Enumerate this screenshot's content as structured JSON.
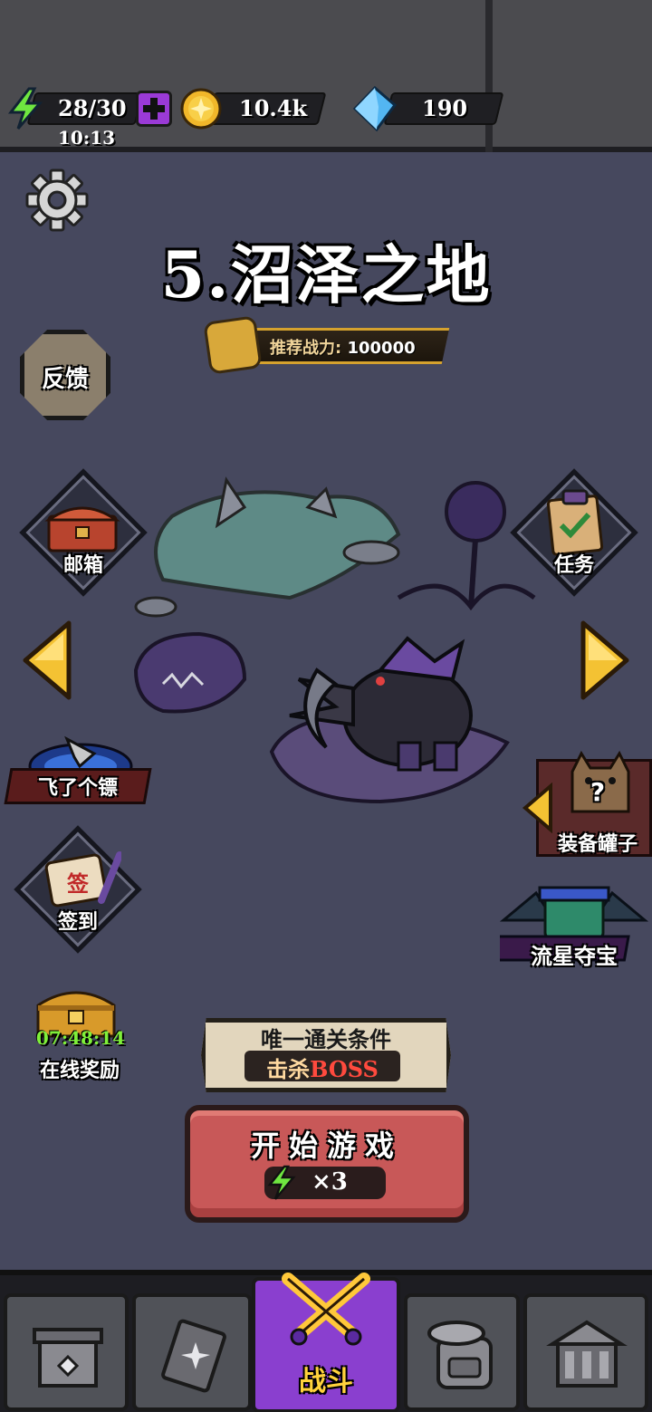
{
  "top_bar": {
    "energy": {
      "value": "28/30",
      "timer": "10:13",
      "icon": "lightning-icon",
      "add_icon": "plus-icon"
    },
    "coins": {
      "value": "10.4k",
      "icon": "gold-coin-icon"
    },
    "gems": {
      "value": "190",
      "icon": "blue-gem-icon"
    }
  },
  "settings": {
    "icon": "gear-icon"
  },
  "level": {
    "title": "5.沼泽之地",
    "recommended_power_label": "推荐战力:",
    "recommended_power_value": "100000"
  },
  "left_menu": {
    "feedback": "反馈",
    "mailbox": "邮箱",
    "flying_dart": "飞了个镖",
    "sign_in": "签到",
    "online_reward_timer": "07:48:14",
    "online_reward": "在线奖励"
  },
  "right_menu": {
    "tasks": "任务",
    "equipment_jar": "装备罐子",
    "equipment_jar_badge": "?",
    "meteor_treasure": "流星夺宝"
  },
  "navigation": {
    "prev_icon": "arrow-left-icon",
    "next_icon": "arrow-right-icon"
  },
  "condition": {
    "title": "唯一通关条件",
    "prefix": "击杀",
    "target": "BOSS"
  },
  "start": {
    "label": "开始游戏",
    "cost": "×3",
    "cost_icon": "lightning-icon"
  },
  "bottom_nav": {
    "active_tab_label": "战斗",
    "tabs": [
      "shop-icon",
      "cards-icon",
      "battle-icon",
      "backpack-icon",
      "forge-icon"
    ]
  },
  "colors": {
    "background": "#46485e",
    "start_button": "#c85858",
    "active_tab": "#8a3fcf",
    "accent_gold": "#ffd23c",
    "energy_green": "#7ff03a"
  }
}
